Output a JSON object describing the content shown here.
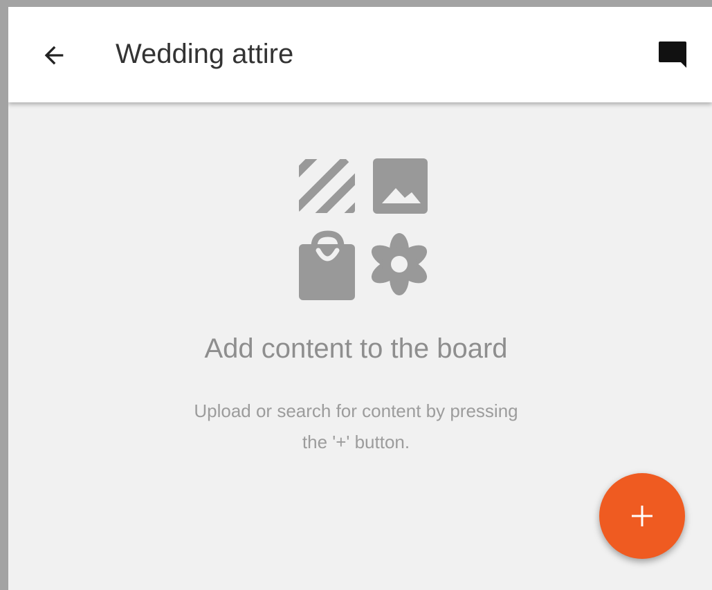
{
  "header": {
    "title": "Wedding attire",
    "back_icon": "arrow-back-icon",
    "comment_icon": "comment-icon"
  },
  "empty_state": {
    "icons": [
      "stripes-pattern-icon",
      "image-icon",
      "shopping-bag-icon",
      "flower-icon"
    ],
    "title": "Add content to the board",
    "subtitle_line1": "Upload or search for content by pressing",
    "subtitle_line2": "the '+' button."
  },
  "fab": {
    "icon": "plus-icon",
    "color": "#ef5b21"
  },
  "colors": {
    "app_bar": "#ffffff",
    "background": "#f1f1f1",
    "icon_gray": "#999999",
    "accent": "#ef5b21"
  }
}
